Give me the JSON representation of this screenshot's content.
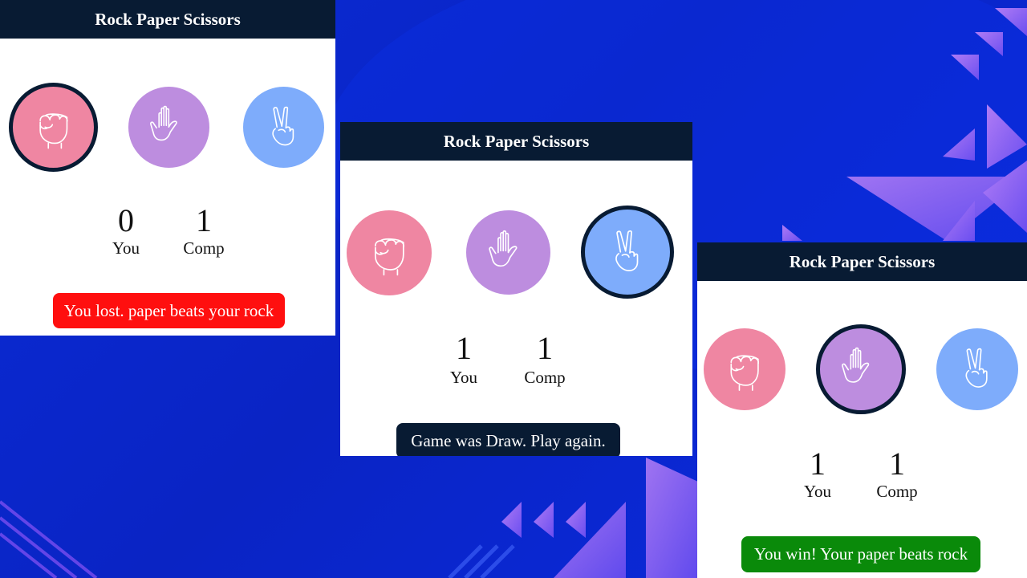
{
  "colors": {
    "header_bg": "#081b33",
    "rock": "#ef86a2",
    "paper": "#bd8ddf",
    "scissors": "#7eacfb",
    "lose": "#ff0f0f",
    "draw": "#081b33",
    "win": "#0a8a0a"
  },
  "panels": [
    {
      "title": "Rock Paper Scissors",
      "selected": "rock",
      "you_score": "0",
      "comp_score": "1",
      "you_label": "You",
      "comp_label": "Comp",
      "result": "You lost. paper beats your rock",
      "result_status": "lose"
    },
    {
      "title": "Rock Paper Scissors",
      "selected": "scissors",
      "you_score": "1",
      "comp_score": "1",
      "you_label": "You",
      "comp_label": "Comp",
      "result": "Game was Draw. Play again.",
      "result_status": "draw"
    },
    {
      "title": "Rock Paper Scissors",
      "selected": "paper",
      "you_score": "1",
      "comp_score": "1",
      "you_label": "You",
      "comp_label": "Comp",
      "result": "You win! Your paper beats rock",
      "result_status": "win"
    }
  ],
  "icons": {
    "rock": "fist-icon",
    "paper": "open-hand-icon",
    "scissors": "peace-hand-icon"
  }
}
